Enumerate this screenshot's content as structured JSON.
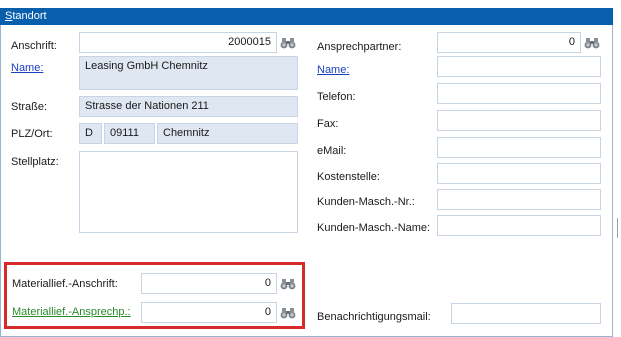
{
  "panel": {
    "title_accel": "S",
    "title_rest": "tandort"
  },
  "left": {
    "anschrift_label": "Anschrift:",
    "anschrift_value": "2000015",
    "name_label": "Name:",
    "name_value": "Leasing GmbH Chemnitz",
    "strasse_label": "Straße:",
    "strasse_value": "Strasse der Nationen 211",
    "plzort_label": "PLZ/Ort:",
    "country_value": "D",
    "plz_value": "09111",
    "ort_value": "Chemnitz",
    "stellplatz_label": "Stellplatz:",
    "stellplatz_value": "",
    "mat_anschrift_label": "Materiallief.-Anschrift:",
    "mat_anschrift_value": "0",
    "mat_ansprech_label": "Materiallief.-Ansprechp.:",
    "mat_ansprech_value": "0"
  },
  "right": {
    "ansprechpartner_label": "Ansprechpartner:",
    "ansprechpartner_value": "0",
    "name_label": "Name:",
    "name_value": "",
    "telefon_label": "Telefon:",
    "telefon_value": "",
    "fax_label": "Fax:",
    "fax_value": "",
    "email_label": "eMail:",
    "email_value": "",
    "kostenstelle_label": "Kostenstelle:",
    "kostenstelle_value": "",
    "kunden_nr_label": "Kunden-Masch.-Nr.:",
    "kunden_nr_value": "",
    "kunden_name_label": "Kunden-Masch.-Name:",
    "kunden_name_value": "",
    "benachrichtigung_label": "Benachrichtigungsmail:",
    "benachrichtigung_value": ""
  },
  "icons": {
    "lookup": "binoculars-icon"
  },
  "colors": {
    "titlebar": "#0a5fad",
    "readonly_field": "#dfe7f3",
    "link": "#1a3fbf",
    "link_green": "#2a8a2a",
    "highlight": "#d52b2b"
  }
}
